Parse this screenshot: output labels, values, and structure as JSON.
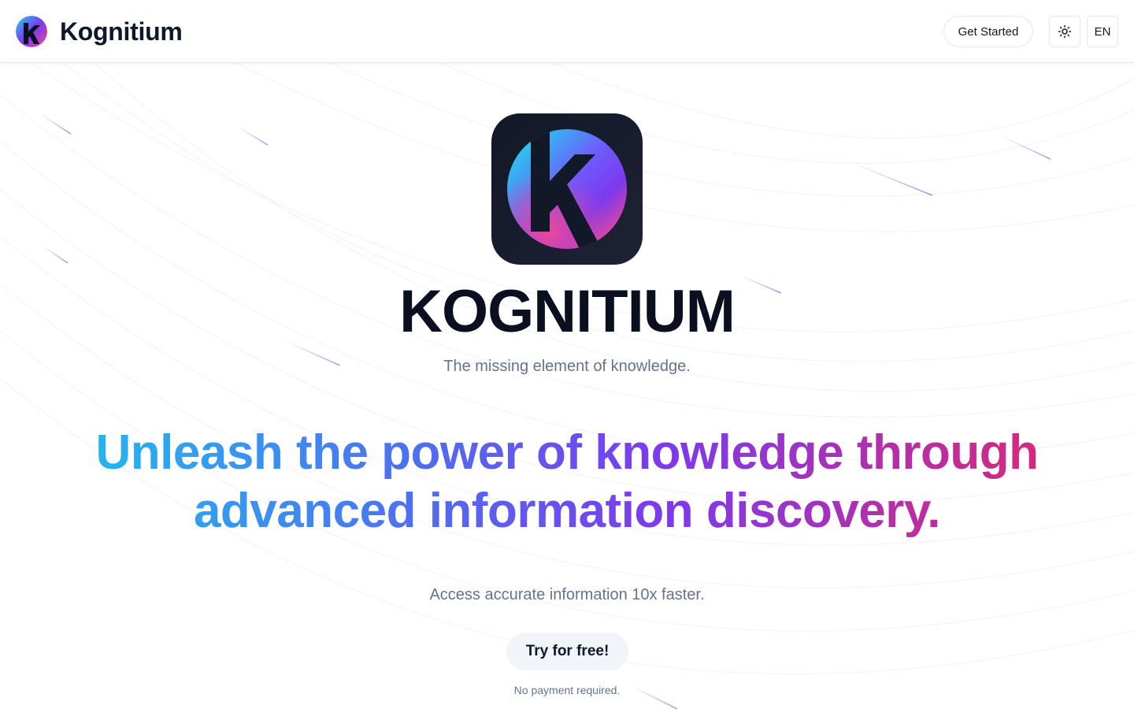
{
  "header": {
    "brand_name": "Kognitium",
    "get_started_label": "Get Started",
    "theme_icon": "sun-icon",
    "language_label": "EN"
  },
  "hero": {
    "app_icon": "kognitium-logo-icon",
    "title": "KOGNITIUM",
    "tagline": "The missing element of knowledge.",
    "headline": "Unleash the power of knowledge through advanced information discovery.",
    "subheadline": "Access accurate information 10x faster.",
    "cta_label": "Try for free!",
    "cta_note": "No payment required."
  },
  "colors": {
    "text_primary": "#0f172a",
    "text_muted": "#64748b",
    "gradient_start": "#22b8f0",
    "gradient_mid": "#7c3aed",
    "gradient_end": "#db2777",
    "icon_background": "#111827"
  }
}
